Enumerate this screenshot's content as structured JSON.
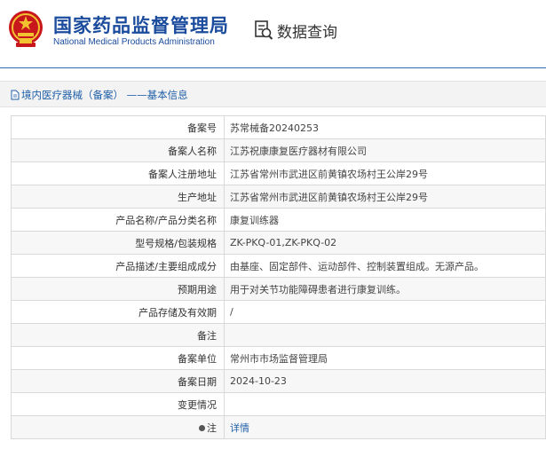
{
  "header": {
    "org_name_cn": "国家药品监督管理局",
    "org_name_en": "National Medical Products Administration",
    "page_title": "数据查询",
    "emblem_icon": "national-emblem-icon",
    "query_icon": "search-document-icon",
    "brand_color": "#1a4b9c"
  },
  "breadcrumb": {
    "icon": "document-icon",
    "text": "境内医疗器械（备案） ——基本信息"
  },
  "record": {
    "rows": [
      {
        "label": "备案号",
        "value": "苏常械备20240253"
      },
      {
        "label": "备案人名称",
        "value": "江苏祝康康复医疗器材有限公司"
      },
      {
        "label": "备案人注册地址",
        "value": "江苏省常州市武进区前黄镇农场村王公岸29号"
      },
      {
        "label": "生产地址",
        "value": "江苏省常州市武进区前黄镇农场村王公岸29号"
      },
      {
        "label": "产品名称/产品分类名称",
        "value": "康复训练器"
      },
      {
        "label": "型号规格/包装规格",
        "value": "ZK-PKQ-01,ZK-PKQ-02"
      },
      {
        "label": "产品描述/主要组成成分",
        "value": "由基座、固定部件、运动部件、控制装置组成。无源产品。"
      },
      {
        "label": "预期用途",
        "value": "用于对关节功能障碍患者进行康复训练。"
      },
      {
        "label": "产品存储及有效期",
        "value": "/"
      },
      {
        "label": "备注",
        "value": ""
      },
      {
        "label": "备案单位",
        "value": "常州市市场监督管理局"
      },
      {
        "label": "备案日期",
        "value": "2024-10-23"
      },
      {
        "label": "变更情况",
        "value": ""
      }
    ],
    "note_row": {
      "label": "注",
      "link_text": "详情"
    }
  }
}
